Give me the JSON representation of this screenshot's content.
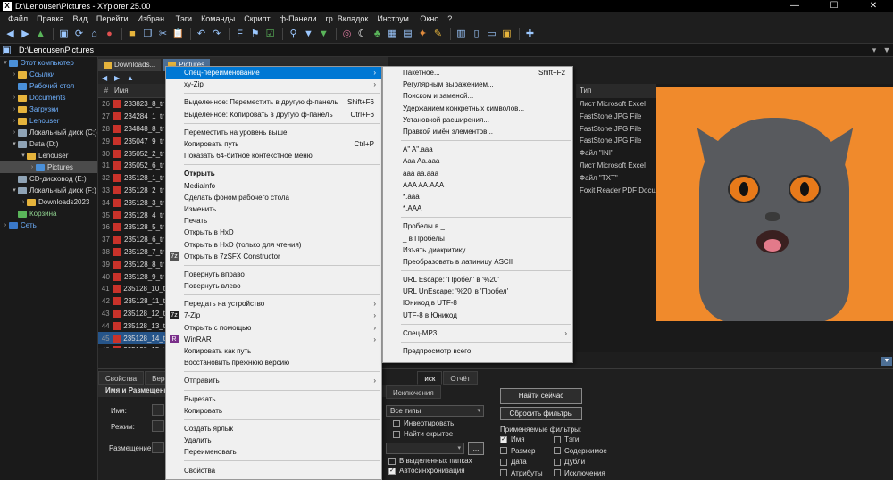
{
  "window": {
    "title": "D:\\Lenouser\\Pictures - XYplorer 25.00",
    "app_icon": "X"
  },
  "menubar": [
    "Файл",
    "Правка",
    "Вид",
    "Перейти",
    "Избран.",
    "Тэги",
    "Команды",
    "Скрипт",
    "ф-Панели",
    "гр. Вкладок",
    "Инструм.",
    "Окно",
    "?"
  ],
  "address": {
    "path": "D:\\Lenouser\\Pictures"
  },
  "tree": [
    {
      "label": "Этот компьютер",
      "indent": 0,
      "icon": "pc",
      "arrow": "▾",
      "style": "blue"
    },
    {
      "label": "Ссылки",
      "indent": 1,
      "icon": "fold",
      "arrow": "›",
      "style": "blue"
    },
    {
      "label": "Рабочий стол",
      "indent": 1,
      "icon": "pc",
      "arrow": "",
      "style": "blue"
    },
    {
      "label": "Documents",
      "indent": 1,
      "icon": "fold",
      "arrow": "›",
      "style": "blue"
    },
    {
      "label": "Загрузки",
      "indent": 1,
      "icon": "fold",
      "arrow": "›",
      "style": "blue"
    },
    {
      "label": "Lenouser",
      "indent": 1,
      "icon": "fold",
      "arrow": "›",
      "style": "blue"
    },
    {
      "label": "Локальный диск (C:)",
      "indent": 1,
      "icon": "disk",
      "arrow": "›",
      "style": ""
    },
    {
      "label": "Data (D:)",
      "indent": 1,
      "icon": "disk",
      "arrow": "▾",
      "style": ""
    },
    {
      "label": "Lenouser",
      "indent": 2,
      "icon": "fold",
      "arrow": "▾",
      "style": ""
    },
    {
      "label": "Pictures",
      "indent": 3,
      "icon": "pc",
      "arrow": "›",
      "style": "sel"
    },
    {
      "label": "CD-дисковод (E:)",
      "indent": 1,
      "icon": "disk",
      "arrow": "",
      "style": ""
    },
    {
      "label": "Локальный диск (F:)",
      "indent": 1,
      "icon": "disk",
      "arrow": "▾",
      "style": ""
    },
    {
      "label": "Downloads2023",
      "indent": 2,
      "icon": "fold",
      "arrow": "›",
      "style": ""
    },
    {
      "label": "Корзина",
      "indent": 1,
      "icon": "rec",
      "arrow": "",
      "style": "green"
    },
    {
      "label": "Сеть",
      "indent": 0,
      "icon": "net",
      "arrow": "›",
      "style": "blue"
    }
  ],
  "tabs": [
    {
      "label": "Downloads...",
      "active": false
    },
    {
      "label": "Pictures",
      "active": true
    }
  ],
  "list": {
    "header_name": "Имя",
    "rows": [
      {
        "n": "26",
        "name": "233823_8_tr",
        "type": "Лист Microsoft Excel"
      },
      {
        "n": "27",
        "name": "234284_1_tr",
        "type": "FastStone JPG File"
      },
      {
        "n": "28",
        "name": "234848_8_tr",
        "type": "FastStone JPG File"
      },
      {
        "n": "29",
        "name": "235047_9_tr",
        "type": "FastStone JPG File"
      },
      {
        "n": "30",
        "name": "235052_2_tr",
        "type": "Файл \"INI\""
      },
      {
        "n": "31",
        "name": "235052_6_tr",
        "type": "Лист Microsoft Excel"
      },
      {
        "n": "32",
        "name": "235128_1_tr",
        "type": "Файл \"TXT\""
      },
      {
        "n": "33",
        "name": "235128_2_tr",
        "type": "Foxit Reader PDF Docu..."
      },
      {
        "n": "34",
        "name": "235128_3_tr",
        "type": ""
      },
      {
        "n": "35",
        "name": "235128_4_tr",
        "type": ""
      },
      {
        "n": "36",
        "name": "235128_5_tr",
        "type": ""
      },
      {
        "n": "37",
        "name": "235128_6_tr",
        "type": ""
      },
      {
        "n": "38",
        "name": "235128_7_tr",
        "type": ""
      },
      {
        "n": "39",
        "name": "235128_8_tr",
        "type": ""
      },
      {
        "n": "40",
        "name": "235128_9_tr",
        "type": ""
      },
      {
        "n": "41",
        "name": "235128_10_t",
        "type": ""
      },
      {
        "n": "42",
        "name": "235128_11_t",
        "type": ""
      },
      {
        "n": "43",
        "name": "235128_12_t",
        "type": ""
      },
      {
        "n": "44",
        "name": "235128_13_t",
        "type": ""
      },
      {
        "n": "45",
        "name": "235128_14_t",
        "type": "",
        "selected": true
      },
      {
        "n": "46",
        "name": "235128_15_t",
        "type": ""
      }
    ],
    "type_header": "Тип"
  },
  "context_menu": [
    {
      "type": "item",
      "label": "Спец-переименование",
      "sub": true,
      "hl": true
    },
    {
      "type": "item",
      "label": "xy-Zip",
      "sub": true
    },
    {
      "type": "sep"
    },
    {
      "type": "item",
      "label": "Выделенное:  Переместить в другую ф-панель",
      "shortcut": "Shift+F6"
    },
    {
      "type": "item",
      "label": "Выделенное:  Копировать в другую ф-панель",
      "shortcut": "Ctrl+F6"
    },
    {
      "type": "sep"
    },
    {
      "type": "item",
      "label": "Переместить на уровень выше"
    },
    {
      "type": "item",
      "label": "Копировать путь",
      "shortcut": "Ctrl+P"
    },
    {
      "type": "item",
      "label": "Показать 64-битное контекстное меню"
    },
    {
      "type": "sep"
    },
    {
      "type": "item",
      "label": "Открыть",
      "bold": true
    },
    {
      "type": "item",
      "label": "MediaInfo"
    },
    {
      "type": "item",
      "label": "Сделать фоном рабочего стола"
    },
    {
      "type": "item",
      "label": "Изменить"
    },
    {
      "type": "item",
      "label": "Печать"
    },
    {
      "type": "item",
      "label": "Открыть в HxD"
    },
    {
      "type": "item",
      "label": "Открыть в HxD (только для чтения)"
    },
    {
      "type": "item",
      "label": "Открыть в 7zSFX Constructor",
      "icon": "7zsfx",
      "icon_text": "7z"
    },
    {
      "type": "sep"
    },
    {
      "type": "item",
      "label": "Повернуть вправо"
    },
    {
      "type": "item",
      "label": "Повернуть влево"
    },
    {
      "type": "sep"
    },
    {
      "type": "item",
      "label": "Передать на устройство",
      "sub": true
    },
    {
      "type": "item",
      "label": "7-Zip",
      "sub": true,
      "icon": "7z",
      "icon_text": "7z"
    },
    {
      "type": "item",
      "label": "Открыть с помощью",
      "sub": true
    },
    {
      "type": "item",
      "label": "WinRAR",
      "sub": true,
      "icon": "winrar",
      "icon_text": "R"
    },
    {
      "type": "item",
      "label": "Копировать как путь"
    },
    {
      "type": "item",
      "label": "Восстановить прежнюю версию"
    },
    {
      "type": "sep"
    },
    {
      "type": "item",
      "label": "Отправить",
      "sub": true
    },
    {
      "type": "sep"
    },
    {
      "type": "item",
      "label": "Вырезать"
    },
    {
      "type": "item",
      "label": "Копировать"
    },
    {
      "type": "sep"
    },
    {
      "type": "item",
      "label": "Создать ярлык"
    },
    {
      "type": "item",
      "label": "Удалить"
    },
    {
      "type": "item",
      "label": "Переименовать"
    },
    {
      "type": "sep"
    },
    {
      "type": "item",
      "label": "Свойства"
    }
  ],
  "submenu": [
    {
      "type": "item",
      "label": "Пакетное...",
      "shortcut": "Shift+F2"
    },
    {
      "type": "item",
      "label": "Регулярным выражением..."
    },
    {
      "type": "item",
      "label": "Поиском и заменой..."
    },
    {
      "type": "item",
      "label": "Удержанием конкретных символов..."
    },
    {
      "type": "item",
      "label": "Установкой расширения..."
    },
    {
      "type": "item",
      "label": "Правкой имён элементов..."
    },
    {
      "type": "sep"
    },
    {
      "type": "item",
      "label": "A\" A\".aaa"
    },
    {
      "type": "item",
      "label": "Aaa Aa.aaa"
    },
    {
      "type": "item",
      "label": "aaa aa.aaa"
    },
    {
      "type": "item",
      "label": "AAA AA.AAA"
    },
    {
      "type": "item",
      "label": "*.aaa"
    },
    {
      "type": "item",
      "label": "*.AAA"
    },
    {
      "type": "sep"
    },
    {
      "type": "item",
      "label": "Пробелы в _"
    },
    {
      "type": "item",
      "label": "_ в Пробелы"
    },
    {
      "type": "item",
      "label": "Изъять диакритику"
    },
    {
      "type": "item",
      "label": "Преобразовать в латиницу ASCII"
    },
    {
      "type": "sep"
    },
    {
      "type": "item",
      "label": "URL Escape:  'Пробел' в '%20'"
    },
    {
      "type": "item",
      "label": "URL UnEscape:  '%20' в 'Пробел'"
    },
    {
      "type": "item",
      "label": "Юникод в UTF-8"
    },
    {
      "type": "item",
      "label": "UTF-8 в Юникод"
    },
    {
      "type": "sep"
    },
    {
      "type": "item",
      "label": "Спец-MP3",
      "sub": true
    },
    {
      "type": "sep"
    },
    {
      "type": "item",
      "label": "Предпросмотр всего"
    }
  ],
  "bottom": {
    "tabs": [
      "Свойства",
      "Верс",
      "иск",
      "Отчёт"
    ],
    "subtab": "Исключения",
    "section": "Имя и Размещени",
    "name_label": "Имя:",
    "mode_label": "Режим:",
    "place_label": "Размещение:",
    "types_select": "Все типы",
    "invert": "Инвертировать",
    "find_hidden": "Найти скрытое",
    "in_selected": "В выделенных папках",
    "autosync": "Автосинхронизация",
    "find_now": "Найти сейчас",
    "reset_filters": "Сбросить фильтры",
    "applied_filters": "Применяемые фильтры:",
    "filters": [
      {
        "label": "Имя",
        "on": true
      },
      {
        "label": "Тэги",
        "on": false
      },
      {
        "label": "Размер",
        "on": false
      },
      {
        "label": "Содержимое",
        "on": false
      },
      {
        "label": "Дата",
        "on": false
      },
      {
        "label": "Дубли",
        "on": false
      },
      {
        "label": "Атрибуты",
        "on": false
      },
      {
        "label": "Исключения",
        "on": false
      }
    ]
  }
}
